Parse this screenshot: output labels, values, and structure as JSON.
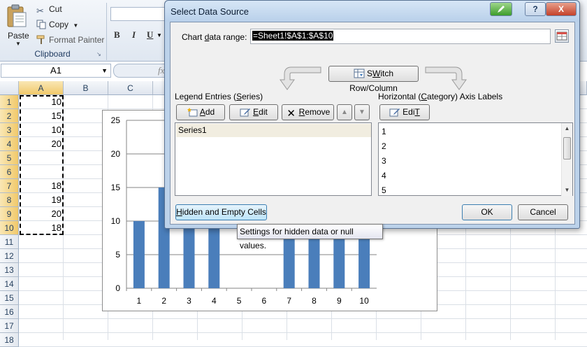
{
  "ribbon": {
    "paste_label": "Paste",
    "cut_label": "Cut",
    "copy_label": "Copy",
    "format_painter_label": "Format Painter",
    "group_label": "Clipboard",
    "bold": "B",
    "italic": "I",
    "underline": "U"
  },
  "formula_bar": {
    "name_box": "A1",
    "fx": "fx"
  },
  "grid": {
    "columns": [
      "A",
      "B",
      "C"
    ],
    "rows": [
      "1",
      "2",
      "3",
      "4",
      "5",
      "6",
      "7",
      "8",
      "9",
      "10",
      "11",
      "12",
      "13",
      "14",
      "15",
      "16",
      "17",
      "18"
    ],
    "col_a_values": [
      "10",
      "15",
      "10",
      "20",
      "",
      "",
      "18",
      "19",
      "20",
      "18"
    ]
  },
  "chart_data": {
    "type": "bar",
    "categories": [
      "1",
      "2",
      "3",
      "4",
      "5",
      "6",
      "7",
      "8",
      "9",
      "10"
    ],
    "series": [
      {
        "name": "Series1",
        "values": [
          10,
          15,
          10,
          20,
          null,
          null,
          18,
          19,
          20,
          18
        ]
      }
    ],
    "ylim": [
      0,
      25
    ],
    "yticks": [
      0,
      5,
      10,
      15,
      20,
      25
    ],
    "grid": true,
    "color": "#4a7ebb"
  },
  "dialog": {
    "title": "Select Data Source",
    "range_label_pre": "Chart ",
    "range_label_key": "d",
    "range_label_post": "ata range:",
    "range_value": "=Sheet1!$A$1:$A$10",
    "switch_btn_key": "W",
    "switch_btn_post": "itch Row/Column",
    "switch_btn_pre": "S",
    "legend_label_pre": "Legend Entries (",
    "legend_label_key": "S",
    "legend_label_post": "eries)",
    "add_btn_key": "A",
    "add_btn_post": "dd",
    "edit_btn_key": "E",
    "edit_btn_post": "dit",
    "remove_btn_key": "R",
    "remove_btn_post": "emove",
    "series_items": [
      "Series1"
    ],
    "axis_label_pre": "Horizontal (",
    "axis_label_key": "C",
    "axis_label_post": "ategory) Axis Labels",
    "axis_edit_key": "T",
    "axis_edit_pre": "Edi",
    "axis_items": [
      "1",
      "2",
      "3",
      "4",
      "5"
    ],
    "hidden_btn_key": "H",
    "hidden_btn_post": "idden and Empty Cells",
    "ok_label": "OK",
    "cancel_label": "Cancel",
    "tooltip": "Settings for hidden data or null values.",
    "help_label": "?",
    "close_label": "X"
  }
}
